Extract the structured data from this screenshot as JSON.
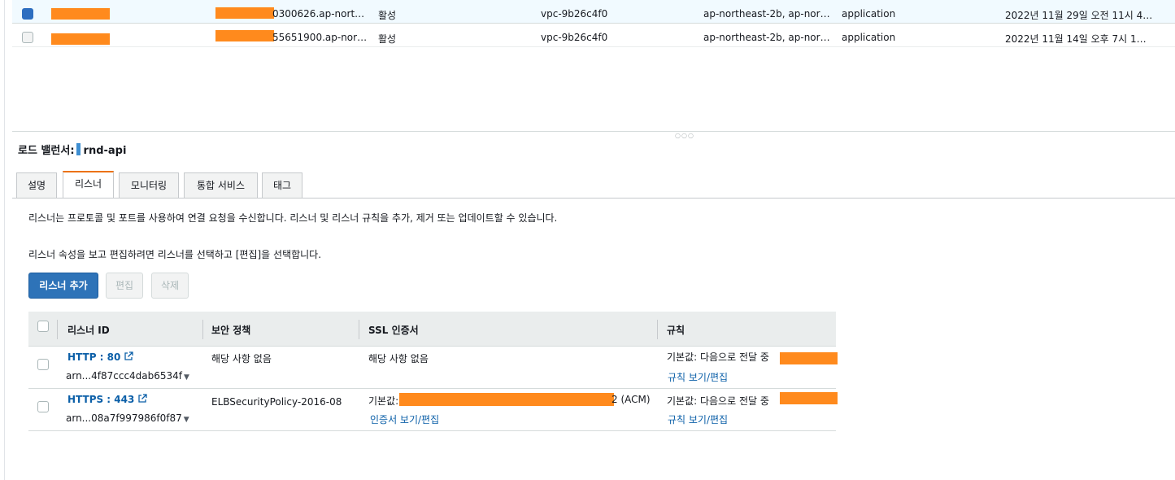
{
  "load_balancers": [
    {
      "selected": true,
      "dns_suffix": "0300626.ap-nort…",
      "state": "활성",
      "vpc": "vpc-9b26c4f0",
      "zones": "ap-northeast-2b, ap-nor…",
      "type": "application",
      "created": "2022년 11월 29일 오전 11시 4…"
    },
    {
      "selected": false,
      "dns_suffix": "55651900.ap-nor…",
      "state": "활성",
      "vpc": "vpc-9b26c4f0",
      "zones": "ap-northeast-2b, ap-nor…",
      "type": "application",
      "created": "2022년 11월 14일 오후 7시 1…"
    }
  ],
  "detail": {
    "label": "로드 밸런서:",
    "name": "rnd-api"
  },
  "tabs": [
    "설명",
    "리스너",
    "모니터링",
    "통합 서비스",
    "태그"
  ],
  "active_tab": "리스너",
  "description": {
    "line1": "리스너는 프로토콜 및 포트를 사용하여 연결 요청을 수신합니다. 리스너 및 리스너 규칙을 추가, 제거 또는 업데이트할 수 있습니다.",
    "line2": "리스너 속성을 보고 편집하려면 리스너를 선택하고 [편집]을 선택합니다."
  },
  "buttons": {
    "add": "리스너 추가",
    "edit": "편집",
    "delete": "삭제"
  },
  "listeners": {
    "columns": [
      "리스너 ID",
      "보안 정책",
      "SSL 인증서",
      "규칙"
    ],
    "rows": [
      {
        "protocol": "HTTP : 80",
        "arn": "arn...4f87ccc4dab6534f",
        "policy": "해당 사항 없음",
        "ssl": "해당 사항 없음",
        "ssl_link": "",
        "rule": "기본값:  다음으로 전달 중",
        "rule_link": "규칙 보기/편집"
      },
      {
        "protocol": "HTTPS : 443",
        "arn": "arn...08a7f997986f0f87",
        "policy": "ELBSecurityPolicy-2016-08",
        "ssl": "기본값:",
        "ssl_suffix": "2 (ACM)",
        "ssl_link": "인증서 보기/편집",
        "rule": "기본값:  다음으로 전달 중",
        "rule_link": "규칙 보기/편집"
      }
    ]
  },
  "colors": {
    "accent_tab": "#ec7211",
    "primary_button": "#2e73b8",
    "link": "#0b5fa8",
    "redaction": "#ff8a1d"
  }
}
